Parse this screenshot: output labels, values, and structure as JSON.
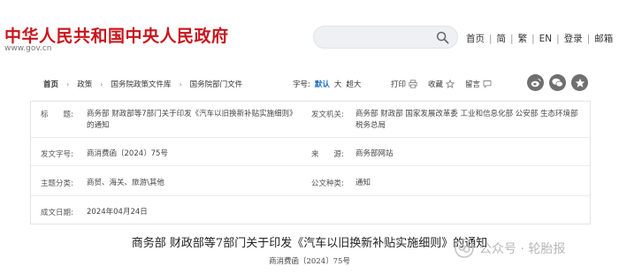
{
  "header": {
    "site_title": "中华人民共和国中央人民政府",
    "site_domain": "www.gov.cn",
    "search": {
      "value": "",
      "placeholder": ""
    },
    "toplinks": [
      "首页",
      "简",
      "繁",
      "EN",
      "登录",
      "邮箱"
    ]
  },
  "breadcrumb": [
    "首页",
    "政策",
    "国务院政策文件库",
    "国务院部门文件"
  ],
  "font_size": {
    "label": "字号:",
    "options": [
      "默认",
      "大",
      "超大"
    ],
    "selected": "默认"
  },
  "actions": {
    "print": "打印",
    "favorite": "收藏",
    "comment": "留言"
  },
  "share_icons": [
    "weibo-icon",
    "wechat-icon",
    "qzone-icon"
  ],
  "info": {
    "title_label": "标　　题:",
    "title_value": "商务部 财政部等7部门关于印发《汽车以旧换新补贴实施细则》的通知",
    "issuer_label": "发文机关:",
    "issuer_value": "商务部 财政部 国家发展改革委 工业和信息化部 公安部 生态环境部 税务总局",
    "docno_label": "发文字号:",
    "docno_value": "商消费函〔2024〕75号",
    "source_label": "来　　源:",
    "source_value": "商务部网站",
    "category_label": "主题分类:",
    "category_value": "商贸、海关、旅游\\其他",
    "doctype_label": "公文种类:",
    "doctype_value": "通知",
    "date_label": "成文日期:",
    "date_value": "2024年04月24日"
  },
  "document": {
    "title": "商务部 财政部等7部门关于印发《汽车以旧换新补贴实施细则》的通知",
    "number": "商消费函〔2024〕75号"
  },
  "watermark": "公众号 · 轮胎报",
  "colors": {
    "brand_red": "#c8161d",
    "accent_blue": "#1f6fc5",
    "share_grey": "#6f6f6f"
  }
}
